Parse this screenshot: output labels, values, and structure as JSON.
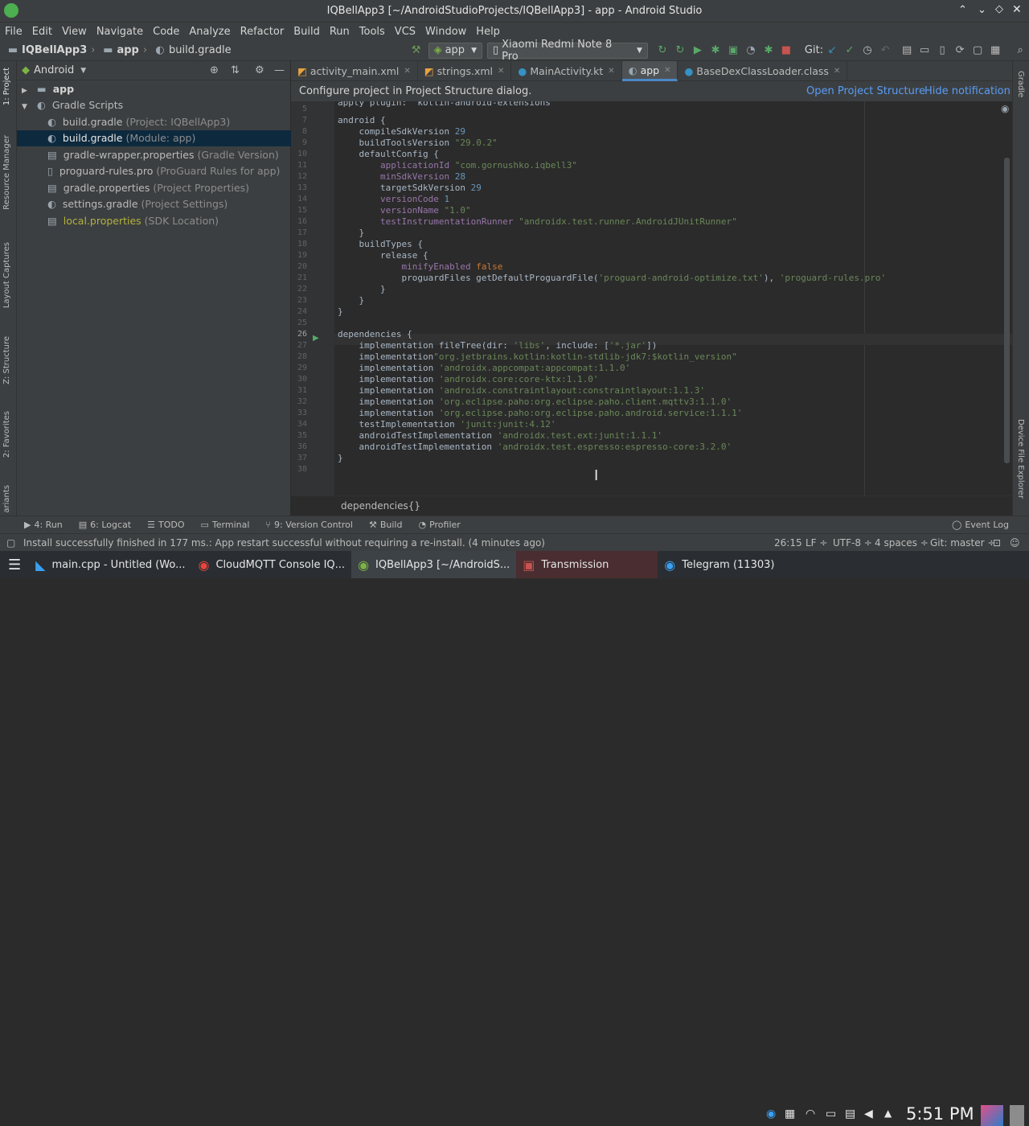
{
  "window": {
    "title": "IQBellApp3 [~/AndroidStudioProjects/IQBellApp3] - app - Android Studio"
  },
  "menu": [
    "File",
    "Edit",
    "View",
    "Navigate",
    "Code",
    "Analyze",
    "Refactor",
    "Build",
    "Run",
    "Tools",
    "VCS",
    "Window",
    "Help"
  ],
  "breadcrumb": {
    "project": "IQBellApp3",
    "module": "app",
    "file": "build.gradle"
  },
  "toolbar": {
    "config": "app",
    "device": "Xiaomi Redmi Note 8 Pro",
    "git_label": "Git:"
  },
  "left_tools": [
    "1: Project",
    "Resource Manager",
    "Layout Captures",
    "Z: Structure",
    "2: Favorites",
    "ariants"
  ],
  "right_tools": [
    "Gradle",
    "Device File Explorer"
  ],
  "project_panel": {
    "view": "Android",
    "items": [
      {
        "name": "app",
        "hint": ""
      },
      {
        "name": "Gradle Scripts",
        "hint": ""
      },
      {
        "name": "build.gradle",
        "hint": "(Project: IQBellApp3)"
      },
      {
        "name": "build.gradle",
        "hint": "(Module: app)"
      },
      {
        "name": "gradle-wrapper.properties",
        "hint": "(Gradle Version)"
      },
      {
        "name": "proguard-rules.pro",
        "hint": "(ProGuard Rules for app)"
      },
      {
        "name": "gradle.properties",
        "hint": "(Project Properties)"
      },
      {
        "name": "settings.gradle",
        "hint": "(Project Settings)"
      },
      {
        "name": "local.properties",
        "hint": "(SDK Location)"
      }
    ]
  },
  "tabs": [
    "activity_main.xml",
    "strings.xml",
    "MainActivity.kt",
    "app",
    "BaseDexClassLoader.class"
  ],
  "notification": {
    "text": "Configure project in Structure dialog.",
    "text_full": "Configure project in Project Structure dialog.",
    "open": "Open Project Structure",
    "hide": "Hide notification"
  },
  "code": {
    "top_partial": "apply plugin: 'kotlin-android-extensions'",
    "lines": [
      {
        "n": "5",
        "t": ""
      },
      {
        "n": "7",
        "t": "android {"
      },
      {
        "n": "8",
        "t": "    compileSdkVersion 29"
      },
      {
        "n": "9",
        "t": "    buildToolsVersion \"29.0.2\""
      },
      {
        "n": "10",
        "t": "    defaultConfig {"
      },
      {
        "n": "11",
        "t": "        applicationId \"com.gornushko.iqbell3\""
      },
      {
        "n": "12",
        "t": "        minSdkVersion 28"
      },
      {
        "n": "13",
        "t": "        targetSdkVersion 29"
      },
      {
        "n": "14",
        "t": "        versionCode 1"
      },
      {
        "n": "15",
        "t": "        versionName \"1.0\""
      },
      {
        "n": "16",
        "t": "        testInstrumentationRunner \"androidx.test.runner.AndroidJUnitRunner\""
      },
      {
        "n": "17",
        "t": "    }"
      },
      {
        "n": "18",
        "t": "    buildTypes {"
      },
      {
        "n": "19",
        "t": "        release {"
      },
      {
        "n": "20",
        "t": "            minifyEnabled false"
      },
      {
        "n": "21",
        "t": "            proguardFiles getDefaultProguardFile('proguard-android-optimize.txt'), 'proguard-rules.pro'"
      },
      {
        "n": "22",
        "t": "        }"
      },
      {
        "n": "23",
        "t": "    }"
      },
      {
        "n": "24",
        "t": "}"
      },
      {
        "n": "25",
        "t": ""
      },
      {
        "n": "26",
        "t": "dependencies {"
      },
      {
        "n": "27",
        "t": "    implementation fileTree(dir: 'libs', include: ['*.jar'])"
      },
      {
        "n": "28",
        "t": "    implementation\"org.jetbrains.kotlin:kotlin-stdlib-jdk7:$kotlin_version\""
      },
      {
        "n": "29",
        "t": "    implementation 'androidx.appcompat:appcompat:1.1.0'"
      },
      {
        "n": "30",
        "t": "    implementation 'androidx.core:core-ktx:1.1.0'"
      },
      {
        "n": "31",
        "t": "    implementation 'androidx.constraintlayout:constraintlayout:1.1.3'"
      },
      {
        "n": "32",
        "t": "    implementation 'org.eclipse.paho:org.eclipse.paho.client.mqttv3:1.1.0'"
      },
      {
        "n": "33",
        "t": "    implementation 'org.eclipse.paho:org.eclipse.paho.android.service:1.1.1'"
      },
      {
        "n": "34",
        "t": "    testImplementation 'junit:junit:4.12'"
      },
      {
        "n": "35",
        "t": "    androidTestImplementation 'androidx.test.ext:junit:1.1.1'"
      },
      {
        "n": "36",
        "t": "    androidTestImplementation 'androidx.test.espresso:espresso-core:3.2.0'"
      },
      {
        "n": "37",
        "t": "}"
      },
      {
        "n": "38",
        "t": ""
      }
    ]
  },
  "editor_breadcrumb": "dependencies{}",
  "bottom_tabs": [
    "4: Run",
    "6: Logcat",
    "TODO",
    "Terminal",
    "9: Version Control",
    "Build",
    "Profiler"
  ],
  "event_log": "Event Log",
  "status": {
    "message": "Install successfully finished in 177 ms.: App restart successful without requiring a re-install. (4 minutes ago)",
    "position": "26:15",
    "line_sep": "LF ÷",
    "encoding": "UTF-8 ÷",
    "indent": "4 spaces ÷",
    "git": "Git: master ÷"
  },
  "taskbar": {
    "tasks": [
      "main.cpp - Untitled (Wo...",
      "CloudMQTT Console IQ...",
      "IQBellApp3 [~/AndroidS...",
      "Transmission",
      "Telegram (11303)"
    ],
    "clock": "5:51 PM"
  },
  "colors": {
    "accent": "#4a88c7",
    "keyword": "#cc7832",
    "string": "#6a8759",
    "number": "#6897bb",
    "property": "#9876aa"
  }
}
